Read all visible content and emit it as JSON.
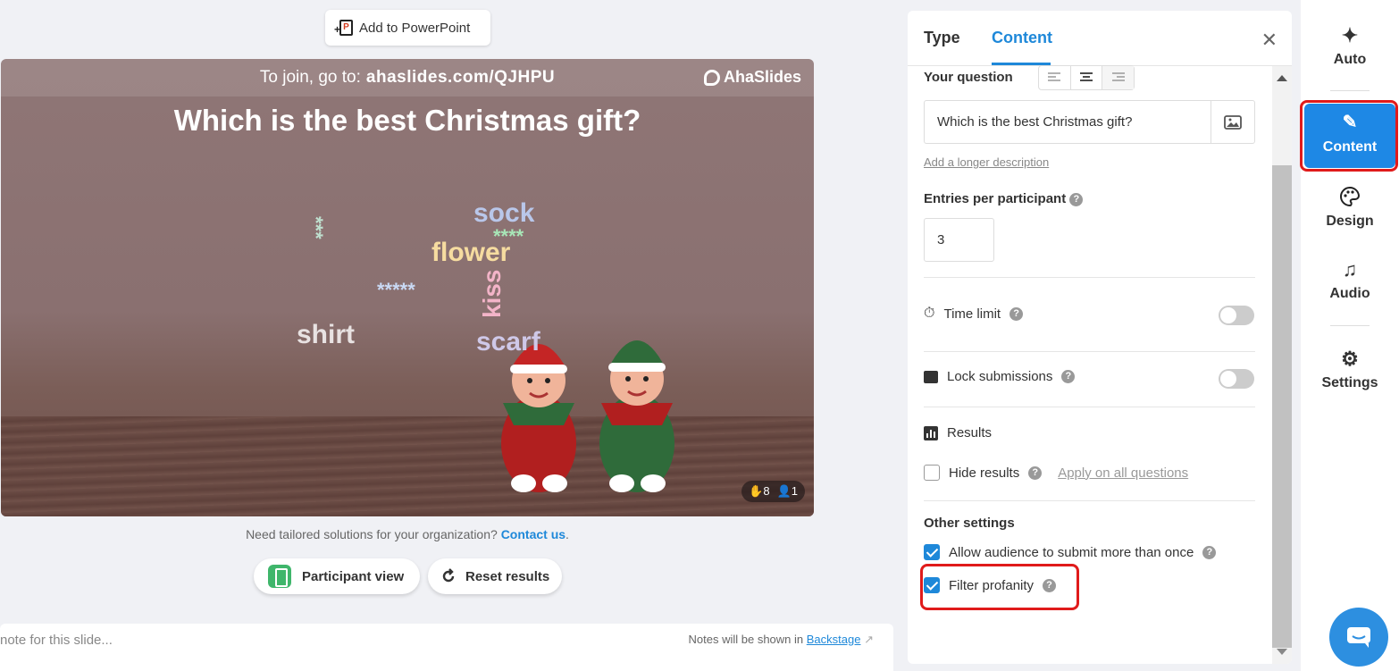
{
  "toolbar": {
    "add_to_powerpoint": "Add to PowerPoint"
  },
  "slide": {
    "join_prefix": "To join, go to:",
    "join_url": "ahaslides.com/QJHPU",
    "brand": "AhaSlides",
    "question": "Which is the best Christmas gift?",
    "words": [
      {
        "text": "sock",
        "color": "#b9c7ea"
      },
      {
        "text": "****",
        "color": "#a8e6b7"
      },
      {
        "text": "flower",
        "color": "#f6dca0"
      },
      {
        "text": "*****",
        "color": "#c9d9f4"
      },
      {
        "text": "kiss",
        "color": "#f3b4c8"
      },
      {
        "text": "shirt",
        "color": "#e8e2e2"
      },
      {
        "text": "scarf",
        "color": "#cfc8e8"
      },
      {
        "text": "***",
        "color": "#bfe0cf"
      }
    ],
    "counter": {
      "responses": "8",
      "participants": "1"
    }
  },
  "footer": {
    "tailored_text": "Need tailored solutions for your organization?",
    "contact_link": "Contact us",
    "participant_view": "Participant view",
    "reset_results": "Reset results",
    "notes_placeholder": "note for this slide...",
    "notes_info": "Notes will be shown in",
    "backstage_link": "Backstage"
  },
  "panel": {
    "tabs": {
      "type": "Type",
      "content": "Content"
    },
    "your_question_label": "Your question",
    "question_value": "Which is the best Christmas gift?",
    "add_description": "Add a longer description",
    "entries_label": "Entries per participant",
    "entries_value": "3",
    "time_limit": "Time limit",
    "lock_submissions": "Lock submissions",
    "results": "Results",
    "hide_results": "Hide results",
    "apply_all": "Apply on all questions",
    "other_settings": "Other settings",
    "allow_multiple": "Allow audience to submit more than once",
    "filter_profanity": "Filter profanity"
  },
  "rail": {
    "auto": "Auto",
    "content": "Content",
    "design": "Design",
    "audio": "Audio",
    "settings": "Settings"
  },
  "colors": {
    "accent": "#1e88e5",
    "highlight": "#e01b1b"
  }
}
